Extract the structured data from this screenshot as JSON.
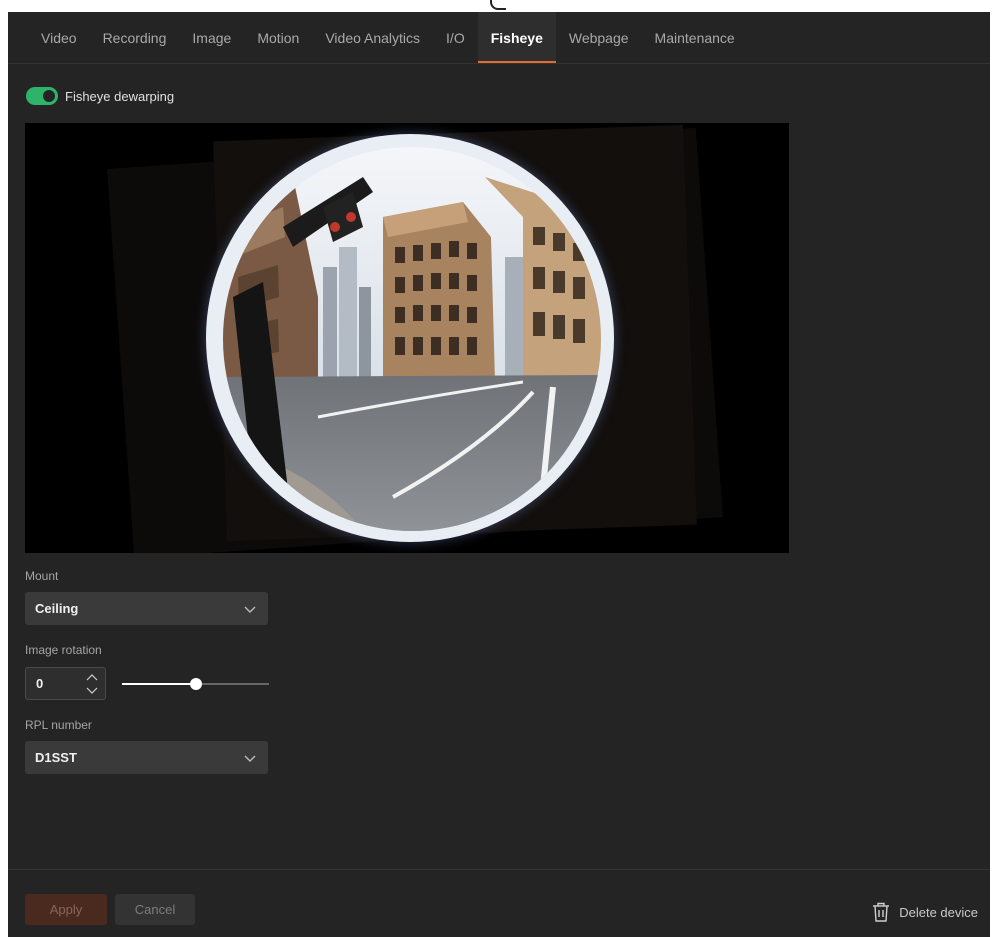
{
  "tabs": [
    {
      "label": "Video",
      "active": false
    },
    {
      "label": "Recording",
      "active": false
    },
    {
      "label": "Image",
      "active": false
    },
    {
      "label": "Motion",
      "active": false
    },
    {
      "label": "Video Analytics",
      "active": false
    },
    {
      "label": "I/O",
      "active": false
    },
    {
      "label": "Fisheye",
      "active": true
    },
    {
      "label": "Webpage",
      "active": false
    },
    {
      "label": "Maintenance",
      "active": false
    }
  ],
  "dewarping": {
    "label": "Fisheye dewarping",
    "enabled": true
  },
  "preview": {
    "icon": "fisheye-preview-image"
  },
  "mount": {
    "label": "Mount",
    "value": "Ceiling"
  },
  "rotation": {
    "label": "Image rotation",
    "value": "0",
    "slider_fraction": 0.5
  },
  "rpl": {
    "label": "RPL number",
    "value": "D1SST"
  },
  "footer": {
    "apply_label": "Apply",
    "cancel_label": "Cancel",
    "delete_label": "Delete device"
  },
  "colors": {
    "background": "#242424",
    "accent": "#e36b2c",
    "toggle_on": "#2eb36a"
  }
}
